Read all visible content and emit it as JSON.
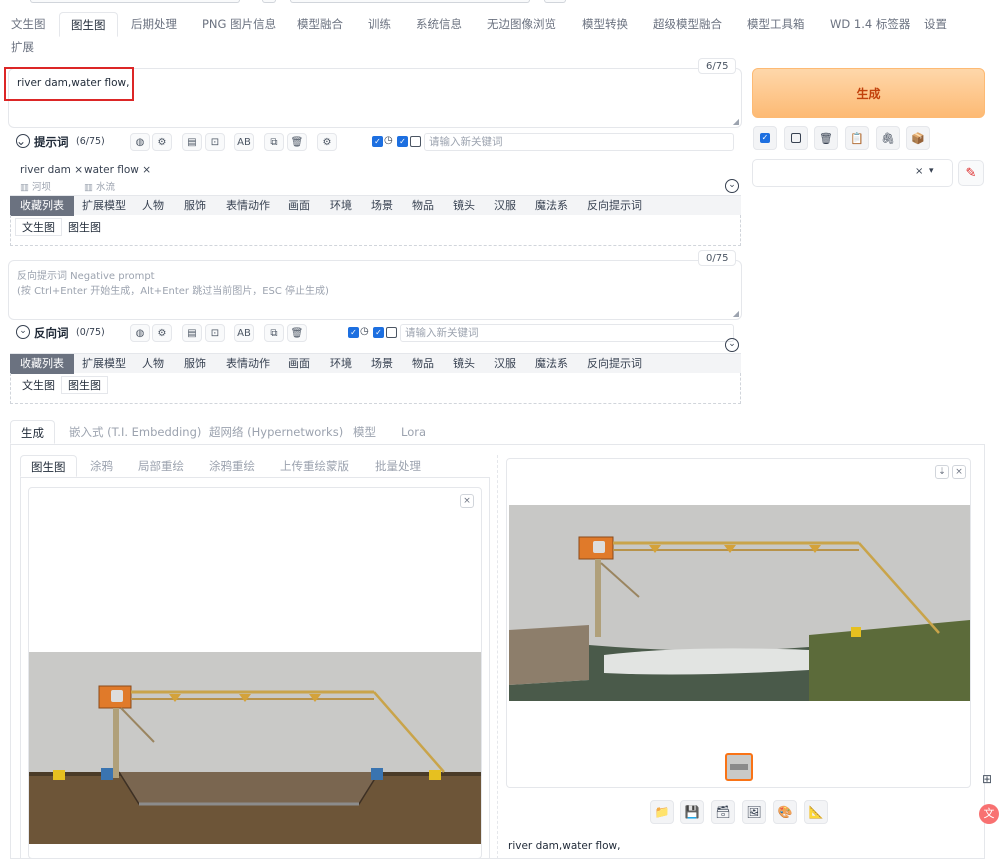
{
  "top_tabs": [
    {
      "label": "文生图",
      "active": false
    },
    {
      "label": "图生图",
      "active": true
    },
    {
      "label": "后期处理",
      "active": false
    },
    {
      "label": "PNG 图片信息",
      "active": false
    },
    {
      "label": "模型融合",
      "active": false
    },
    {
      "label": "训练",
      "active": false
    },
    {
      "label": "系统信息",
      "active": false
    },
    {
      "label": "无边图像浏览",
      "active": false
    },
    {
      "label": "模型转换",
      "active": false
    },
    {
      "label": "超级模型融合",
      "active": false
    },
    {
      "label": "模型工具箱",
      "active": false
    },
    {
      "label": "WD 1.4 标签器",
      "active": false
    },
    {
      "label": "设置",
      "active": false
    },
    {
      "label": "扩展",
      "active": false
    }
  ],
  "prompt": {
    "value": "river dam,water flow,",
    "counter": "6/75",
    "label": "提示词",
    "count": "(6/75)",
    "keyword_placeholder": "请输入新关键词",
    "tags": [
      {
        "en": "river dam",
        "zh": "河坝"
      },
      {
        "en": "water flow",
        "zh": "水流"
      }
    ]
  },
  "negative": {
    "placeholder_line1": "反向提示词 Negative prompt",
    "placeholder_line2": "(按 Ctrl+Enter 开始生成，Alt+Enter 跳过当前图片，ESC 停止生成)",
    "counter": "0/75",
    "label": "反向词",
    "count": "(0/75)",
    "keyword_placeholder": "请输入新关键词"
  },
  "tag_categories": [
    "收藏列表",
    "扩展模型",
    "人物",
    "服饰",
    "表情动作",
    "画面",
    "环境",
    "场景",
    "物品",
    "镜头",
    "汉服",
    "魔法系",
    "反向提示词"
  ],
  "fav_subtabs": [
    "文生图",
    "图生图"
  ],
  "generate_button": "生成",
  "settings_tabs": [
    "生成",
    "嵌入式 (T.I. Embedding)",
    "超网络 (Hypernetworks)",
    "模型",
    "Lora"
  ],
  "img_tabs": [
    "图生图",
    "涂鸦",
    "局部重绘",
    "涂鸦重绘",
    "上传重绘蒙版",
    "批量处理"
  ],
  "output_caption": "river dam,water flow,",
  "colors": {
    "accent": "#f97316",
    "generate_bg": "#fdba74",
    "check_blue": "#1d6fe0"
  }
}
